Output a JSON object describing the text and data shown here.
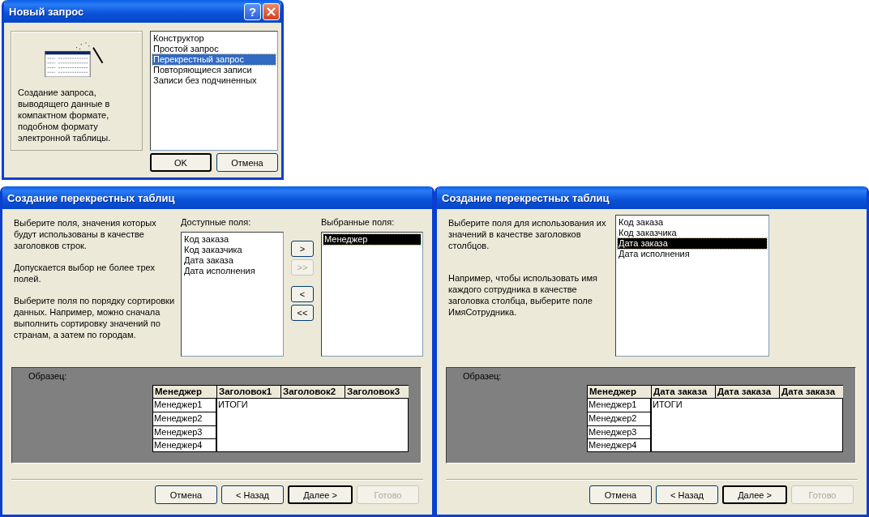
{
  "new_query": {
    "title": "Новый запрос",
    "help_glyph": "?",
    "description": "Создание запроса, выводящего данные в компактном формате, подобном формату электронной таблицы.",
    "items": [
      {
        "label": "Конструктор",
        "selected": false
      },
      {
        "label": "Простой запрос",
        "selected": false
      },
      {
        "label": "Перекрестный запрос",
        "selected": true
      },
      {
        "label": "Повторяющиеся записи",
        "selected": false
      },
      {
        "label": "Записи без подчиненных",
        "selected": false
      }
    ],
    "buttons": [
      {
        "label": "OK",
        "default": true
      },
      {
        "label": "Отмена",
        "default": false
      }
    ]
  },
  "wizards": [
    {
      "kind": "two_lists",
      "title": "Создание перекрестных таблиц",
      "instructions": [
        "Выберите поля, значения которых будут использованы в качестве заголовков строк.",
        "Допускается выбор не более трех полей.",
        "Выберите поля по порядку сортировки данных.  Например, можно сначала выполнить сортировку значений по странам, а затем по городам."
      ],
      "available_label": "Доступные поля:",
      "available_fields": [
        {
          "label": "Код заказа",
          "selected": false
        },
        {
          "label": "Код заказчика",
          "selected": false
        },
        {
          "label": "Дата заказа",
          "selected": false
        },
        {
          "label": "Дата исполнения",
          "selected": false
        }
      ],
      "move_buttons": [
        {
          "label": ">",
          "disabled": false
        },
        {
          "label": ">>",
          "disabled": true
        },
        {
          "label": "<",
          "disabled": false
        },
        {
          "label": "<<",
          "disabled": false
        }
      ],
      "selected_label": "Выбранные поля:",
      "selected_fields": [
        {
          "label": "Менеджер",
          "selected": true
        }
      ],
      "sample": {
        "label": "Образец:",
        "columns": [
          "Менеджер",
          "Заголовок1",
          "Заголовок2",
          "Заголовок3"
        ],
        "rows": [
          "Менеджер1",
          "Менеджер2",
          "Менеджер3",
          "Менеджер4"
        ],
        "total": "ИТОГИ"
      },
      "buttons": [
        {
          "label": "Отмена",
          "default": false,
          "disabled": false
        },
        {
          "label": "< Назад",
          "default": false,
          "disabled": false
        },
        {
          "label": "Далее >",
          "default": true,
          "disabled": false
        },
        {
          "label": "Готово",
          "default": false,
          "disabled": true
        }
      ]
    },
    {
      "kind": "one_list",
      "title": "Создание перекрестных таблиц",
      "instructions": [
        "Выберите поля для использования их значений в качестве заголовков столбцов.",
        "Например, чтобы использовать имя каждого сотрудника в качестве заголовка столбца, выберите поле ИмяСотрудника."
      ],
      "available_fields": [
        {
          "label": "Код заказа",
          "selected": false
        },
        {
          "label": "Код заказчика",
          "selected": false
        },
        {
          "label": "Дата заказа",
          "selected": true
        },
        {
          "label": "Дата исполнения",
          "selected": false
        }
      ],
      "sample": {
        "label": "Образец:",
        "columns": [
          "Менеджер",
          "Дата заказа",
          "Дата заказа",
          "Дата заказа"
        ],
        "rows": [
          "Менеджер1",
          "Менеджер2",
          "Менеджер3",
          "Менеджер4"
        ],
        "total": "ИТОГИ"
      },
      "buttons": [
        {
          "label": "Отмена",
          "default": false,
          "disabled": false
        },
        {
          "label": "< Назад",
          "default": false,
          "disabled": false
        },
        {
          "label": "Далее >",
          "default": true,
          "disabled": false
        },
        {
          "label": "Готово",
          "default": false,
          "disabled": true
        }
      ]
    }
  ]
}
